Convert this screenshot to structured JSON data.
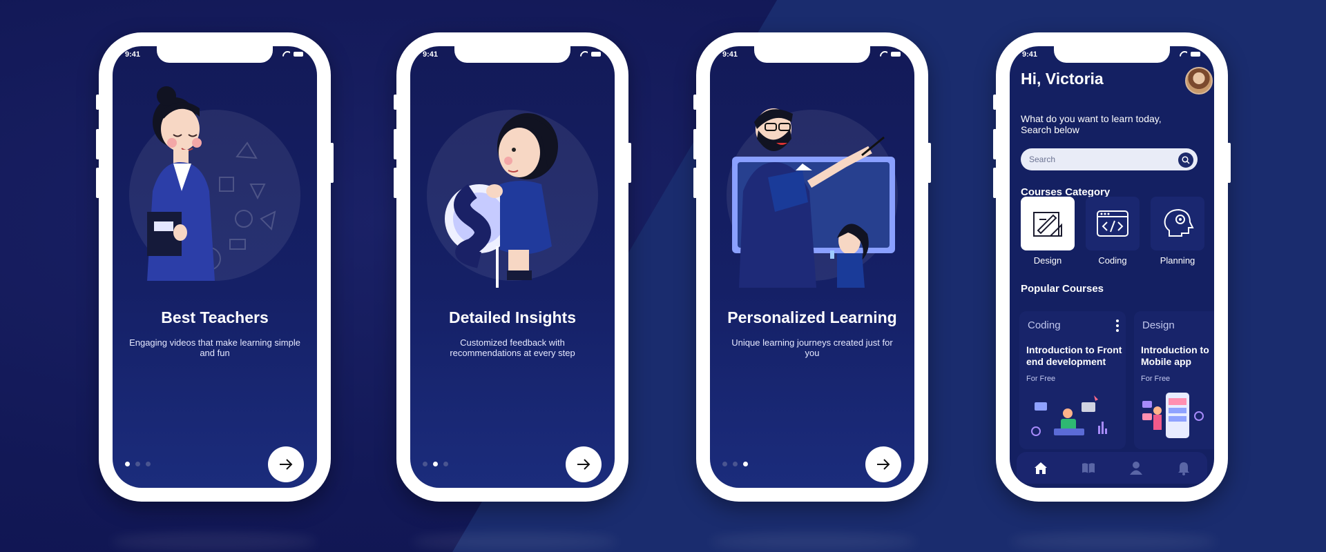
{
  "status_time": "9:41",
  "onboarding": [
    {
      "title": "Best Teachers",
      "subtitle": "Engaging videos that make learning simple and fun",
      "active_dot": 0,
      "dots": 3
    },
    {
      "title": "Detailed Insights",
      "subtitle": "Customized feedback with recommendations at every step",
      "active_dot": 1,
      "dots": 3
    },
    {
      "title": "Personalized Learning",
      "subtitle": "Unique learning journeys created just for you",
      "active_dot": 2,
      "dots": 3
    }
  ],
  "home": {
    "greeting": "Hi, Victoria",
    "question": "What do you want to learn today, Search below",
    "search_placeholder": "Search",
    "categories_title": "Courses Category",
    "categories": [
      {
        "label": "Design",
        "icon": "design-drawing-icon",
        "selected": true
      },
      {
        "label": "Coding",
        "icon": "code-window-icon",
        "selected": false
      },
      {
        "label": "Planning",
        "icon": "head-gear-icon",
        "selected": false
      }
    ],
    "popular_title": "Popular Courses",
    "courses": [
      {
        "category": "Coding",
        "title": "Introduction to Front end development",
        "price": "For Free"
      },
      {
        "category": "Design",
        "title": "Introduction to Mobile app",
        "price": "For Free"
      }
    ],
    "tabs": [
      {
        "icon": "home-icon",
        "active": true
      },
      {
        "icon": "book-icon",
        "active": false
      },
      {
        "icon": "profile-icon",
        "active": false
      },
      {
        "icon": "bell-icon",
        "active": false
      }
    ]
  },
  "colors": {
    "background": "#141a58",
    "screen": "#152066",
    "accent": "#ffffff",
    "card": "#18246a"
  }
}
